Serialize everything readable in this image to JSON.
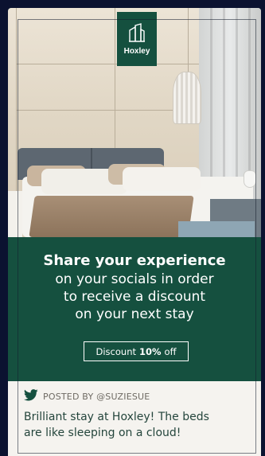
{
  "brand": {
    "name": "Hoxley",
    "logo_icon": "building-icon",
    "primary_color": "#15503f",
    "background_color": "#0b1230"
  },
  "promo": {
    "headline": "Share your experience",
    "lines": [
      "on your socials in order",
      "to receive a discount",
      "on your next stay"
    ]
  },
  "discount": {
    "prefix": "Discount",
    "amount": "10%",
    "suffix": "off"
  },
  "post": {
    "icon": "twitter-bird-icon",
    "posted_by": "POSTED BY @SUZIESUE",
    "text_line1": "Brilliant stay at Hoxley! The beds",
    "text_line2": "are like sleeping on a cloud!"
  }
}
